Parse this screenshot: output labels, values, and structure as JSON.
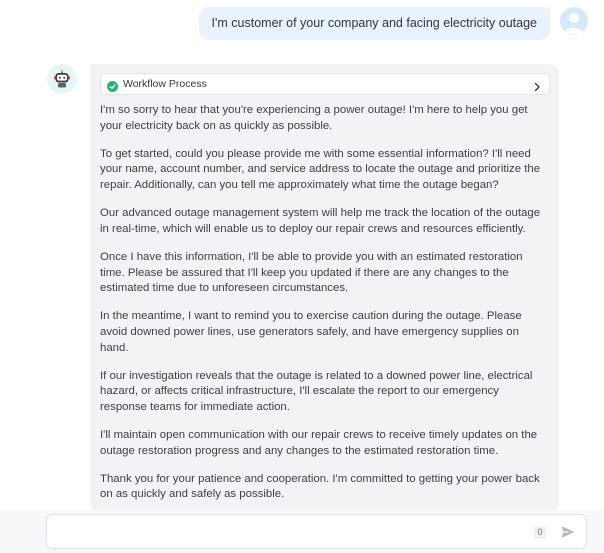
{
  "user_message": {
    "text": "I'm customer of your company and facing electricity outage",
    "avatar_icon": "user-avatar-icon"
  },
  "bot_message": {
    "avatar_icon": "robot-icon",
    "workflow": {
      "label": "Workflow Process",
      "status_icon": "check-circle-icon",
      "expand_icon": "chevron-right-icon",
      "status_color": "#22b573"
    },
    "paragraphs": [
      "I'm so sorry to hear that you're experiencing a power outage! I'm here to help you get your electricity back on as quickly as possible.",
      "To get started, could you please provide me with some essential information? I'll need your name, account number, and service address to locate the outage and prioritize the repair. Additionally, can you tell me approximately what time the outage began?",
      "Our advanced outage management system will help me track the location of the outage in real-time, which will enable us to deploy our repair crews and resources efficiently.",
      "Once I have this information, I'll be able to provide you with an estimated restoration time. Please be assured that I'll keep you updated if there are any changes to the estimated time due to unforeseen circumstances.",
      "In the meantime, I want to remind you to exercise caution during the outage. Please avoid downed power lines, use generators safely, and have emergency supplies on hand.",
      "If our investigation reveals that the outage is related to a downed power line, electrical hazard, or affects critical infrastructure, I'll escalate the report to our emergency response teams for immediate action.",
      "I'll maintain open communication with our repair crews to receive timely updates on the outage restoration progress and any changes to the estimated restoration time.",
      "Thank you for your patience and cooperation. I'm committed to getting your power back on as quickly and safely as possible."
    ]
  },
  "composer": {
    "value": "",
    "placeholder": "",
    "char_count": "0",
    "send_icon": "send-icon"
  },
  "colors": {
    "user_bubble": "#e8f3fd",
    "bot_bubble": "#f2f3f5",
    "accent": "#22b573"
  }
}
